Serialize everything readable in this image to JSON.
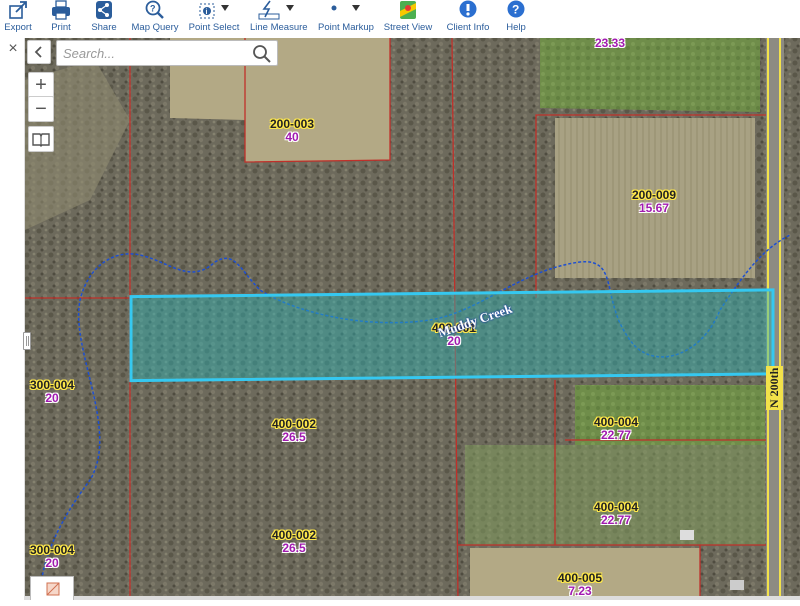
{
  "toolbar": {
    "items": [
      {
        "label": "Export",
        "icon": "export-icon"
      },
      {
        "label": "Print",
        "icon": "print-icon"
      },
      {
        "label": "Share",
        "icon": "share-icon"
      },
      {
        "label": "Map Query",
        "icon": "map-query-icon"
      },
      {
        "label": "Point Select",
        "icon": "point-select-icon"
      },
      {
        "label": "Line Measure",
        "icon": "line-measure-icon"
      },
      {
        "label": "Point Markup",
        "icon": "point-markup-icon"
      },
      {
        "label": "Street View",
        "icon": "street-view-icon"
      },
      {
        "label": "Client Info",
        "icon": "client-info-icon"
      },
      {
        "label": "Help",
        "icon": "help-icon"
      }
    ]
  },
  "search": {
    "placeholder": "Search..."
  },
  "map": {
    "zoom_in": "+",
    "zoom_out": "−",
    "close": "×",
    "parcels": [
      {
        "id": "",
        "acres": "23.33"
      },
      {
        "id": "200-003",
        "acres": "40"
      },
      {
        "id": "200-009",
        "acres": "15.67"
      },
      {
        "id": "400-001",
        "acres": "20"
      },
      {
        "id": "300-004",
        "acres": "20"
      },
      {
        "id": "400-002",
        "acres": "26.5"
      },
      {
        "id": "400-004",
        "acres": "22.77"
      },
      {
        "id": "400-004",
        "acres": "22.77"
      },
      {
        "id": "400-002",
        "acres": "26.5"
      },
      {
        "id": "300-004",
        "acres": "20"
      },
      {
        "id": "400-005",
        "acres": "7.23"
      }
    ],
    "creek_label": "Muddy Creek",
    "road_label": "N 200th",
    "colors": {
      "parcel_line": "#c0302a",
      "selection": "#35c8f0",
      "creek": "#1e4fd0",
      "road": "#f3e24a",
      "acre_text": "#a11ab0"
    }
  }
}
